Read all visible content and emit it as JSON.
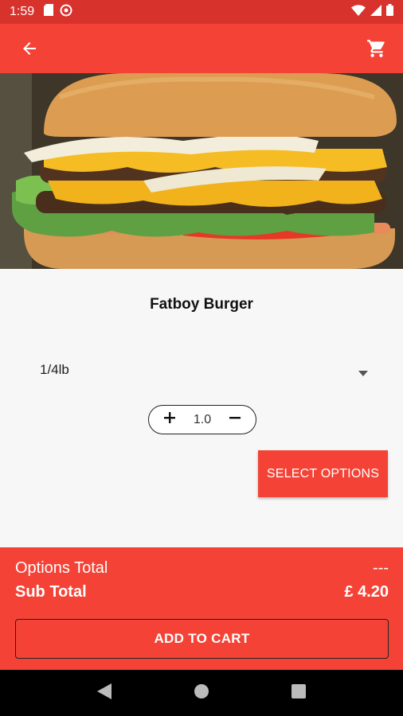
{
  "status_bar": {
    "time": "1:59"
  },
  "product": {
    "name": "Fatboy Burger"
  },
  "size_select": {
    "value": "1/4lb"
  },
  "quantity": {
    "value": "1.0"
  },
  "buttons": {
    "select_options": "SELECT OPTIONS",
    "add_to_cart": "ADD TO CART"
  },
  "totals": {
    "options_label": "Options Total",
    "options_value": "---",
    "subtotal_label": "Sub Total",
    "subtotal_value": "£ 4.20"
  },
  "colors": {
    "primary": "#f44336",
    "status": "#d8322d"
  }
}
